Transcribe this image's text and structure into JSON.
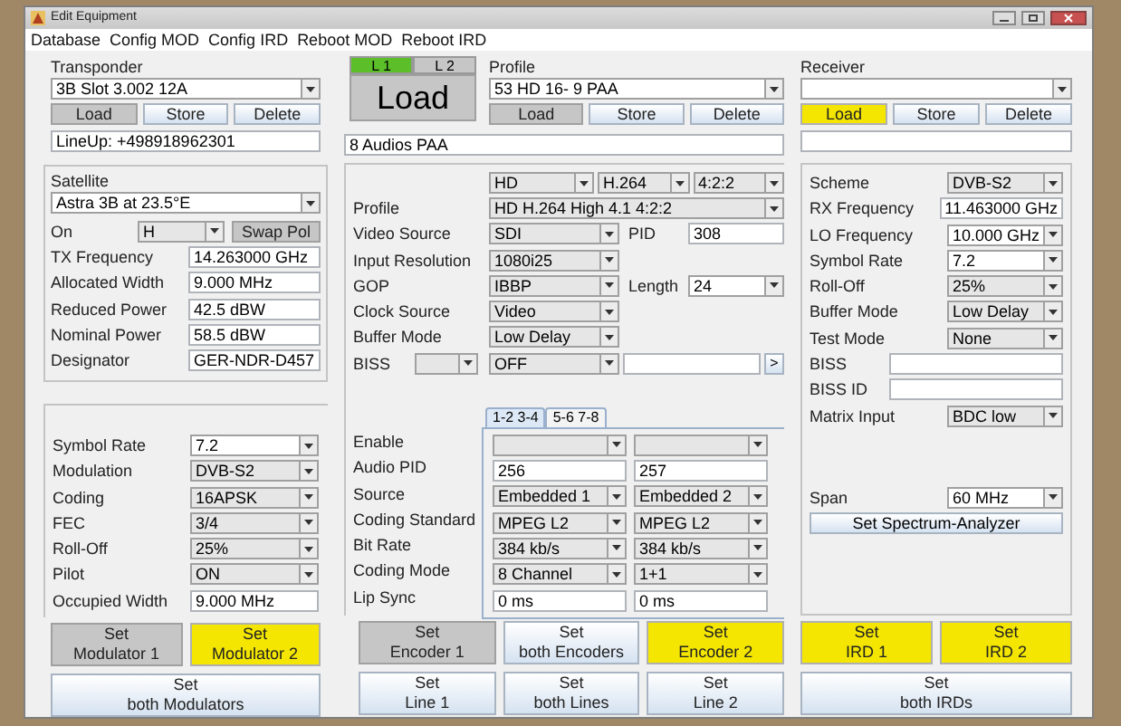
{
  "window": {
    "title": "Edit Equipment"
  },
  "menu": [
    {
      "label": "Database"
    },
    {
      "label": "Config MOD"
    },
    {
      "label": "Config IRD"
    },
    {
      "label": "Reboot MOD"
    },
    {
      "label": "Reboot IRD"
    }
  ],
  "transponder": {
    "label": "Transponder",
    "value": "3B Slot 3.002 12A",
    "buttons": [
      {
        "label": "Load",
        "kind": "pressed"
      },
      {
        "label": "Store",
        "kind": "normal"
      },
      {
        "label": "Delete",
        "kind": "normal"
      }
    ],
    "note": "LineUp: +498918962301"
  },
  "satellite": {
    "label": "Satellite",
    "value": "Astra 3B at 23.5°E",
    "polarization": {
      "label": "On",
      "value": "H",
      "button": {
        "label": "Swap Pol",
        "kind": "pressed"
      }
    },
    "fields": [
      {
        "label": "TX Frequency",
        "value": "14.263000 GHz",
        "kind": "text"
      },
      {
        "label": "Allocated Width",
        "value": "9.000 MHz",
        "kind": "text"
      },
      {
        "label": "Reduced Power",
        "value": "42.5 dBW",
        "kind": "text"
      },
      {
        "label": "Nominal Power",
        "value": "58.5 dBW",
        "kind": "text"
      },
      {
        "label": "Designator",
        "value": "GER-NDR-D457",
        "kind": "text"
      }
    ]
  },
  "modulator": {
    "fields": [
      {
        "label": "Symbol Rate",
        "value": "7.2",
        "kind": "combo"
      },
      {
        "label": "Modulation",
        "value": "DVB-S2",
        "kind": "select"
      },
      {
        "label": "Coding",
        "value": "16APSK",
        "kind": "select"
      },
      {
        "label": "FEC",
        "value": "3/4",
        "kind": "select"
      },
      {
        "label": "Roll-Off",
        "value": "25%",
        "kind": "select"
      },
      {
        "label": "Pilot",
        "value": "ON",
        "kind": "select"
      },
      {
        "label": "Occupied Width",
        "value": "9.000 MHz",
        "kind": "text"
      }
    ]
  },
  "modulator_buttons": [
    {
      "label": "Set\nModulator 1",
      "kind": "pressed"
    },
    {
      "label": "Set\nModulator 2",
      "kind": "highlighted"
    },
    {
      "label": "Set\nboth Modulators",
      "kind": "normal"
    }
  ],
  "line_select": {
    "tabs": [
      {
        "label": "L 1",
        "selected": true
      },
      {
        "label": "L 2",
        "selected": false
      }
    ],
    "button": {
      "label": "Load",
      "kind": "pressed"
    }
  },
  "profile": {
    "label": "Profile",
    "value": "53  HD 16- 9   PAA",
    "buttons": [
      {
        "label": "Load",
        "kind": "pressed"
      },
      {
        "label": "Store",
        "kind": "normal"
      },
      {
        "label": "Delete",
        "kind": "normal"
      }
    ],
    "description": "8 Audios PAA"
  },
  "encoder": {
    "format": [
      {
        "value": "HD",
        "kind": "select"
      },
      {
        "value": "H.264",
        "kind": "select"
      },
      {
        "value": "4:2:2",
        "kind": "select"
      }
    ],
    "fields": [
      {
        "label": "Profile",
        "value": "HD H.264 High 4.1 4:2:2",
        "kind": "select",
        "wide": true
      },
      {
        "label": "Video Source",
        "value": "SDI",
        "kind": "select",
        "extra": {
          "label": "PID",
          "value": "308",
          "kind": "text"
        }
      },
      {
        "label": "Input Resolution",
        "value": "1080i25",
        "kind": "select"
      },
      {
        "label": "GOP",
        "value": "IBBP",
        "kind": "select",
        "extra": {
          "label": "Length",
          "value": "24",
          "kind": "combo"
        }
      },
      {
        "label": "Clock Source",
        "value": "Video",
        "kind": "select"
      },
      {
        "label": "Buffer Mode",
        "value": "Low Delay",
        "kind": "select"
      }
    ],
    "biss": {
      "label": "BISS",
      "value": "OFF",
      "button": ">"
    }
  },
  "audio": {
    "tabs": [
      {
        "label": "1-2 3-4",
        "selected": true
      },
      {
        "label": "5-6 7-8",
        "selected": false
      }
    ],
    "rows": [
      {
        "label": "Enable",
        "cells": [
          {
            "kind": "select"
          },
          {
            "kind": "select"
          }
        ]
      },
      {
        "label": "Audio PID",
        "cells": [
          {
            "kind": "text",
            "value": "256"
          },
          {
            "kind": "text",
            "value": "257"
          }
        ]
      },
      {
        "label": "Source",
        "cells": [
          {
            "kind": "select",
            "value": "Embedded 1"
          },
          {
            "kind": "select",
            "value": "Embedded 2"
          }
        ]
      },
      {
        "label": "Coding Standard",
        "cells": [
          {
            "kind": "select",
            "value": "MPEG L2"
          },
          {
            "kind": "select",
            "value": "MPEG L2"
          }
        ]
      },
      {
        "label": "Bit Rate",
        "cells": [
          {
            "kind": "select",
            "value": "384 kb/s"
          },
          {
            "kind": "select",
            "value": "384 kb/s"
          }
        ]
      },
      {
        "label": "Coding Mode",
        "cells": [
          {
            "kind": "select",
            "value": "8 Channel"
          },
          {
            "kind": "select",
            "value": "1+1"
          }
        ]
      },
      {
        "label": "Lip Sync",
        "cells": [
          {
            "kind": "text",
            "value": "0 ms"
          },
          {
            "kind": "text",
            "value": "0 ms"
          }
        ]
      }
    ]
  },
  "encoder_buttons": [
    {
      "label": "Set\nEncoder 1",
      "kind": "pressed"
    },
    {
      "label": "Set\nboth Encoders",
      "kind": "normal"
    },
    {
      "label": "Set\nEncoder 2",
      "kind": "highlighted"
    }
  ],
  "line_buttons": [
    {
      "label": "Set\nLine 1",
      "kind": "normal"
    },
    {
      "label": "Set\nboth Lines",
      "kind": "normal"
    },
    {
      "label": "Set\nLine 2",
      "kind": "normal"
    }
  ],
  "receiver": {
    "label": "Receiver",
    "buttons": [
      {
        "label": "Load",
        "kind": "highlighted"
      },
      {
        "label": "Store",
        "kind": "normal"
      },
      {
        "label": "Delete",
        "kind": "normal"
      }
    ]
  },
  "ird": {
    "fields": [
      {
        "label": "Scheme",
        "value": "DVB-S2",
        "kind": "select"
      },
      {
        "label": "RX Frequency",
        "value": "11.463000 GHz",
        "kind": "text"
      },
      {
        "label": "LO Frequency",
        "value": "10.000 GHz",
        "kind": "combo"
      },
      {
        "label": "Symbol Rate",
        "value": "7.2",
        "kind": "combo"
      },
      {
        "label": "Roll-Off",
        "value": "25%",
        "kind": "select"
      },
      {
        "label": "Buffer Mode",
        "value": "Low Delay",
        "kind": "select"
      },
      {
        "label": "Test Mode",
        "value": "None",
        "kind": "select"
      },
      {
        "label": "BISS",
        "kind": "longtext"
      },
      {
        "label": "BISS ID",
        "kind": "longtext"
      },
      {
        "label": "Matrix Input",
        "value": "BDC low",
        "kind": "select"
      }
    ],
    "span": {
      "label": "Span",
      "value": "60 MHz",
      "kind": "combo"
    },
    "analyzer_button": "Set Spectrum-Analyzer"
  },
  "ird_buttons": [
    {
      "label": "Set\nIRD 1",
      "kind": "highlighted"
    },
    {
      "label": "Set\nIRD 2",
      "kind": "highlighted"
    },
    {
      "label": "Set\nboth IRDs",
      "kind": "normal"
    }
  ]
}
